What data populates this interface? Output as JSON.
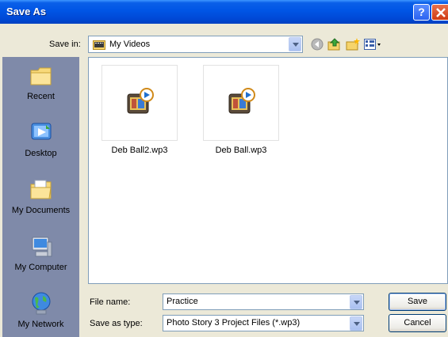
{
  "window": {
    "title": "Save As",
    "help_icon": "question-mark",
    "close_icon": "x"
  },
  "save_in": {
    "label": "Save in:",
    "value": "My Videos",
    "toolbar_icons": [
      "back-icon",
      "up-folder-icon",
      "new-folder-icon",
      "view-menu-icon"
    ]
  },
  "places": [
    {
      "label": "Recent",
      "icon": "recent-folder-icon"
    },
    {
      "label": "Desktop",
      "icon": "desktop-icon"
    },
    {
      "label": "My Documents",
      "icon": "my-documents-icon"
    },
    {
      "label": "My Computer",
      "icon": "my-computer-icon"
    },
    {
      "label": "My Network",
      "icon": "my-network-icon"
    }
  ],
  "files": [
    {
      "name": "Deb Ball2.wp3",
      "icon": "photo-story-project-icon"
    },
    {
      "name": "Deb Ball.wp3",
      "icon": "photo-story-project-icon"
    }
  ],
  "file_name": {
    "label": "File name:",
    "value": "Practice"
  },
  "save_as_type": {
    "label": "Save as type:",
    "value": "Photo Story 3 Project Files (*.wp3)"
  },
  "buttons": {
    "save": "Save",
    "cancel": "Cancel"
  },
  "colors": {
    "titlebar": "#0055e5",
    "window_bg": "#ece9d8",
    "places_bg": "#7f8aa9"
  }
}
